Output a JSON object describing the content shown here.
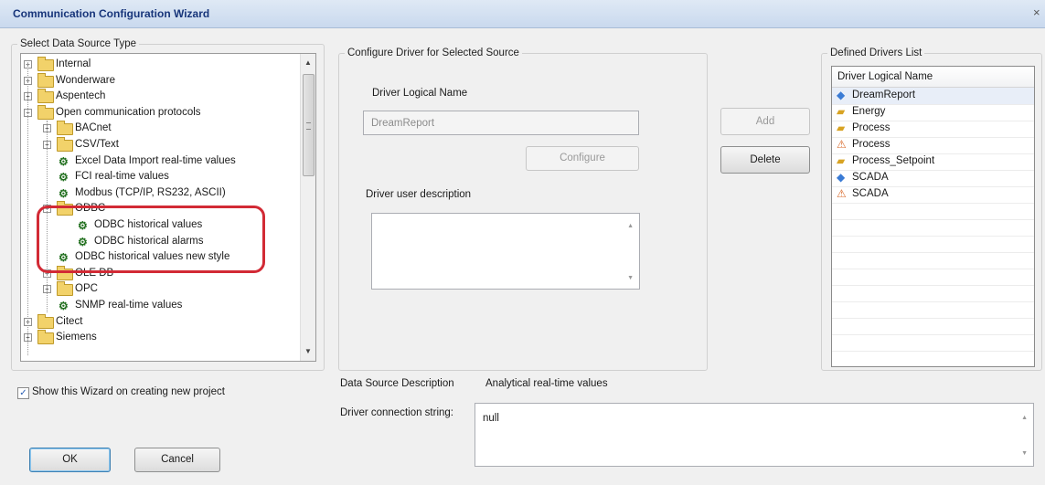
{
  "window": {
    "title": "Communication Configuration Wizard",
    "close_glyph": "×"
  },
  "data_source_type": {
    "legend": "Select Data Source Type",
    "tree": [
      {
        "label": "Internal",
        "kind": "folder",
        "level": 0,
        "expander": "+"
      },
      {
        "label": "Wonderware",
        "kind": "folder",
        "level": 0,
        "expander": "+"
      },
      {
        "label": "Aspentech",
        "kind": "folder",
        "level": 0,
        "expander": "+"
      },
      {
        "label": "Open communication protocols",
        "kind": "folder",
        "level": 0,
        "expander": "−"
      },
      {
        "label": "BACnet",
        "kind": "folder",
        "level": 1,
        "expander": "+"
      },
      {
        "label": "CSV/Text",
        "kind": "folder",
        "level": 1,
        "expander": "+"
      },
      {
        "label": "Excel Data Import real-time values",
        "kind": "driver",
        "level": 1,
        "expander": ""
      },
      {
        "label": "FCI real-time values",
        "kind": "driver",
        "level": 1,
        "expander": ""
      },
      {
        "label": "Modbus (TCP/IP, RS232, ASCII)",
        "kind": "driver",
        "level": 1,
        "expander": ""
      },
      {
        "label": "ODBC",
        "kind": "folder",
        "level": 1,
        "expander": "−"
      },
      {
        "label": "ODBC historical values",
        "kind": "driver",
        "level": 2,
        "expander": ""
      },
      {
        "label": "ODBC historical alarms",
        "kind": "driver",
        "level": 2,
        "expander": ""
      },
      {
        "label": "ODBC historical values new style",
        "kind": "driver",
        "level": 1,
        "expander": ""
      },
      {
        "label": "OLE DB",
        "kind": "folder",
        "level": 1,
        "expander": "+"
      },
      {
        "label": "OPC",
        "kind": "folder",
        "level": 1,
        "expander": "+"
      },
      {
        "label": "SNMP real-time values",
        "kind": "driver",
        "level": 1,
        "expander": ""
      },
      {
        "label": "Citect",
        "kind": "folder",
        "level": 0,
        "expander": "+"
      },
      {
        "label": "Siemens",
        "kind": "folder",
        "level": 0,
        "expander": "+"
      }
    ]
  },
  "configure_driver": {
    "legend": "Configure Driver for Selected Source",
    "logical_name_label": "Driver Logical Name",
    "logical_name_value": "DreamReport",
    "configure_button": "Configure",
    "user_description_label": "Driver user description",
    "user_description_value": ""
  },
  "actions": {
    "add_button": "Add",
    "delete_button": "Delete"
  },
  "defined_drivers": {
    "legend": "Defined Drivers List",
    "column_header": "Driver Logical Name",
    "rows": [
      {
        "name": "DreamReport",
        "icon": "database-icon",
        "selected": true
      },
      {
        "name": "Energy",
        "icon": "folder-driver-icon"
      },
      {
        "name": "Process",
        "icon": "folder-driver-icon"
      },
      {
        "name": "Process",
        "icon": "warning-driver-icon"
      },
      {
        "name": "Process_Setpoint",
        "icon": "folder-driver-icon"
      },
      {
        "name": "SCADA",
        "icon": "database-icon"
      },
      {
        "name": "SCADA",
        "icon": "warning-icon"
      }
    ]
  },
  "description": {
    "label": "Data Source Description",
    "value": "Analytical real-time values",
    "connection_label": "Driver connection string:",
    "connection_value": "null"
  },
  "footer": {
    "show_wizard_label": "Show this Wizard on creating new project",
    "show_wizard_checked": true,
    "ok_button": "OK",
    "cancel_button": "Cancel"
  },
  "colors": {
    "title_text": "#17357a",
    "highlight_ring": "#d22a35",
    "selected_row": "#e8eef8"
  }
}
